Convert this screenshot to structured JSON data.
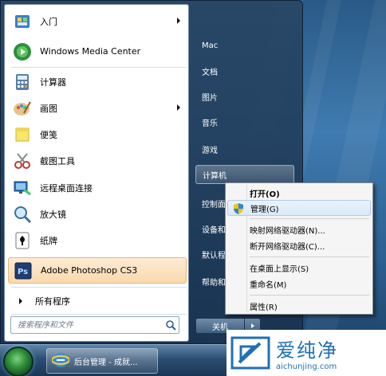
{
  "start_menu": {
    "programs": [
      {
        "label": "入门",
        "icon": "getting-started-icon",
        "has_arrow": true
      },
      {
        "label": "Windows Media Center",
        "icon": "media-center-icon",
        "has_arrow": false
      },
      {
        "label": "计算器",
        "icon": "calculator-icon",
        "has_arrow": false
      },
      {
        "label": "画图",
        "icon": "paint-icon",
        "has_arrow": true
      },
      {
        "label": "便笺",
        "icon": "sticky-notes-icon",
        "has_arrow": false
      },
      {
        "label": "截图工具",
        "icon": "snipping-tool-icon",
        "has_arrow": false
      },
      {
        "label": "远程桌面连接",
        "icon": "remote-desktop-icon",
        "has_arrow": false
      },
      {
        "label": "放大镜",
        "icon": "magnifier-icon",
        "has_arrow": false
      },
      {
        "label": "纸牌",
        "icon": "solitaire-icon",
        "has_arrow": false
      },
      {
        "label": "Adobe Photoshop CS3",
        "icon": "photoshop-icon",
        "has_arrow": false
      }
    ],
    "all_programs_label": "所有程序",
    "search_placeholder": "搜索程序和文件",
    "right_items": [
      {
        "label": "Mac"
      },
      {
        "label": "文档"
      },
      {
        "label": "图片"
      },
      {
        "label": "音乐"
      },
      {
        "label": "游戏"
      },
      {
        "label": "计算机"
      },
      {
        "label": "控制面"
      },
      {
        "label": "设备和"
      },
      {
        "label": "默认程"
      },
      {
        "label": "帮助和"
      }
    ],
    "shutdown_label": "关机"
  },
  "context_menu": {
    "items": [
      {
        "label": "打开(O)"
      },
      {
        "label": "管理(G)"
      },
      {
        "label": "映射网络驱动器(N)..."
      },
      {
        "label": "断开网络驱动器(C)..."
      },
      {
        "label": "在桌面上显示(S)"
      },
      {
        "label": "重命名(M)"
      },
      {
        "label": "属性(R)"
      }
    ]
  },
  "taskbar": {
    "task_label": "后台管理 - 成就..."
  },
  "watermark": {
    "text": "爱纯净",
    "url": "aichunjing.com"
  },
  "colors": {
    "highlight": "#f9d9ae",
    "menu_hover": "#d9e9f8",
    "brand": "#1f6fb8"
  }
}
